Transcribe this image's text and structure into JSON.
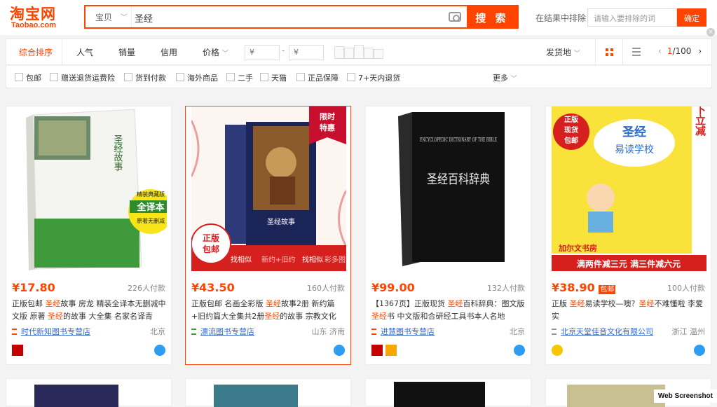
{
  "logo": {
    "main": "淘宝网",
    "sub": "Taobao.com"
  },
  "search": {
    "category": "宝贝",
    "query": "圣经",
    "button": "搜 索"
  },
  "within": {
    "label": "在结果中排除",
    "placeholder": "请输入要排除的词",
    "button": "确定"
  },
  "sort": {
    "active": "综合排序",
    "items": [
      "人气",
      "销量",
      "信用",
      "价格"
    ],
    "price_from": "¥",
    "price_to": "¥",
    "ship": "发货地",
    "page": "1",
    "page_total": "/100"
  },
  "filters": [
    "包邮",
    "赠送退货运费险",
    "货到付款",
    "海外商品",
    "二手",
    "天猫",
    "正品保障",
    "7+天内退货"
  ],
  "more": "更多",
  "products": [
    {
      "price": "¥17.80",
      "paid": "226人付款",
      "t1": "正版包邮 ",
      "h1": "圣经",
      "t2": "故事 房龙 精装全译本无删减中文版 原著 ",
      "h2": "圣经",
      "t3": "的故事 大全集 名家名译青",
      "shop": "时代新知图书专营店",
      "loc": "北京",
      "cover": {
        "title": "圣经故事",
        "seal": "全译本",
        "seal_top": "精装典藏版",
        "seal_bot": "原著无删减"
      }
    },
    {
      "price": "¥43.50",
      "paid": "160人付款",
      "t1": "正版包邮 名画全彩版 ",
      "h1": "圣经",
      "t2": "故事2册 新约篇+旧约篇大全集共2册",
      "h2": "圣经",
      "t3": "的故事 宗教文化",
      "shop": "漂流图书专营店",
      "loc": "山东 济南",
      "cover": {
        "tag1": "限时",
        "tag2": "特惠",
        "stamp1": "正版",
        "stamp2": "包邮",
        "bar1": "找相似",
        "bar2": "新约+旧约",
        "bar3": "找相似",
        "bar4": "彩多图",
        "title": "圣经故事"
      }
    },
    {
      "price": "¥99.00",
      "paid": "132人付款",
      "t1": "【1367页】正版现货 ",
      "h1": "圣经",
      "t2": "百科辞典：图文版",
      "h2": "圣经",
      "t3": "书 中文版和合研经工具书本人名地",
      "shop": "进慧图书专营店",
      "loc": "北京",
      "cover": {
        "en": "ENCYCLOPEDIC DICTIONARY OF THE BIBLE",
        "cn": "圣经百科辞典"
      }
    },
    {
      "price": "¥38.90",
      "paid": "100人付款",
      "t1": "正版 ",
      "h1": "圣经",
      "t2": "易读学校—噢？",
      "h2": "圣经",
      "t3": "不难懂啦 李爱实",
      "shop": "北京天堂佳音文化有限公司",
      "loc": "浙江 温州",
      "coupon": "包邮",
      "cover": {
        "c1": "正版",
        "c2": "现货",
        "c3": "包邮",
        "title": "圣经",
        "sub": "易读学校",
        "right": "拍下立减",
        "shop": "加尔文书房",
        "promo": "满两件减三元  满三件减六元"
      }
    }
  ],
  "watermark": "Web Screenshot"
}
